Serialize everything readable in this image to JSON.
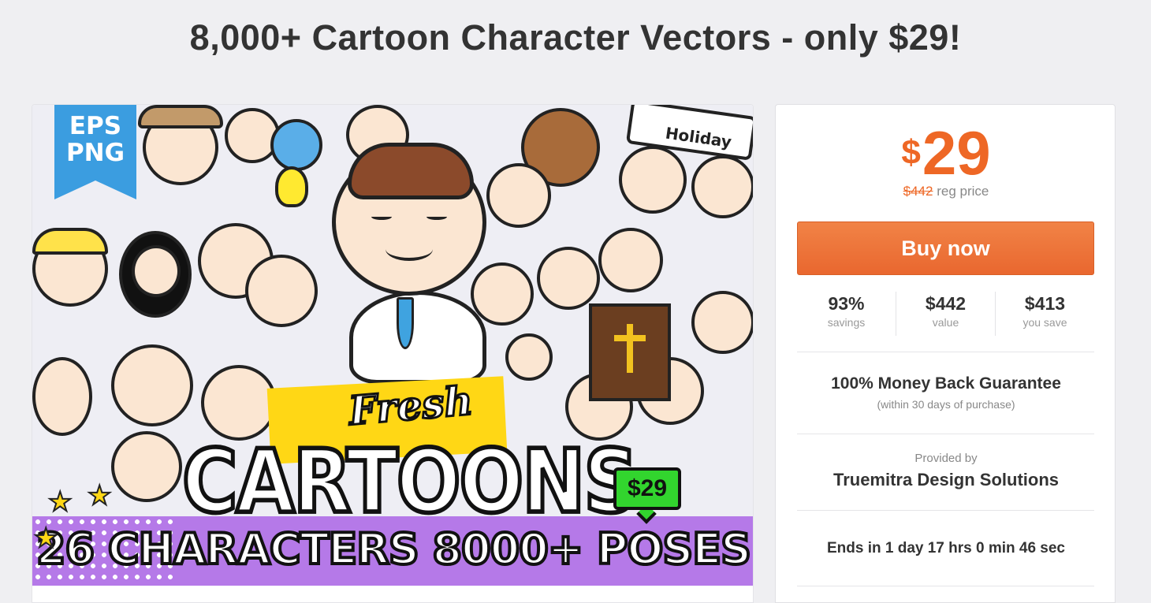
{
  "page": {
    "title": "8,000+ Cartoon Character Vectors - only $29!"
  },
  "product_image": {
    "ribbon_line1": "EPS",
    "ribbon_line2": "PNG",
    "sign_text": "Holiday",
    "fresh": "Fresh",
    "cartoons": "CARTOONS",
    "tagline": "26 CHARACTERS 8000+ POSES",
    "price_badge": "$29"
  },
  "sidebar": {
    "currency_symbol": "$",
    "price": "29",
    "reg_price_value": "$442",
    "reg_price_label": "reg price",
    "buy_label": "Buy now",
    "stats": [
      {
        "value": "93%",
        "label": "savings"
      },
      {
        "value": "$442",
        "label": "value"
      },
      {
        "value": "$413",
        "label": "you save"
      }
    ],
    "guarantee_title": "100% Money Back Guarantee",
    "guarantee_sub": "(within 30 days of purchase)",
    "provided_label": "Provided by",
    "provider_name": "Truemitra Design Solutions",
    "ends_text": "Ends in 1 day 17 hrs 0 min 46 sec"
  },
  "colors": {
    "accent": "#ee6725",
    "background": "#efeff2",
    "ribbon": "#3b9de0",
    "badge_green": "#32d52e",
    "purple_band": "#b579e8"
  }
}
